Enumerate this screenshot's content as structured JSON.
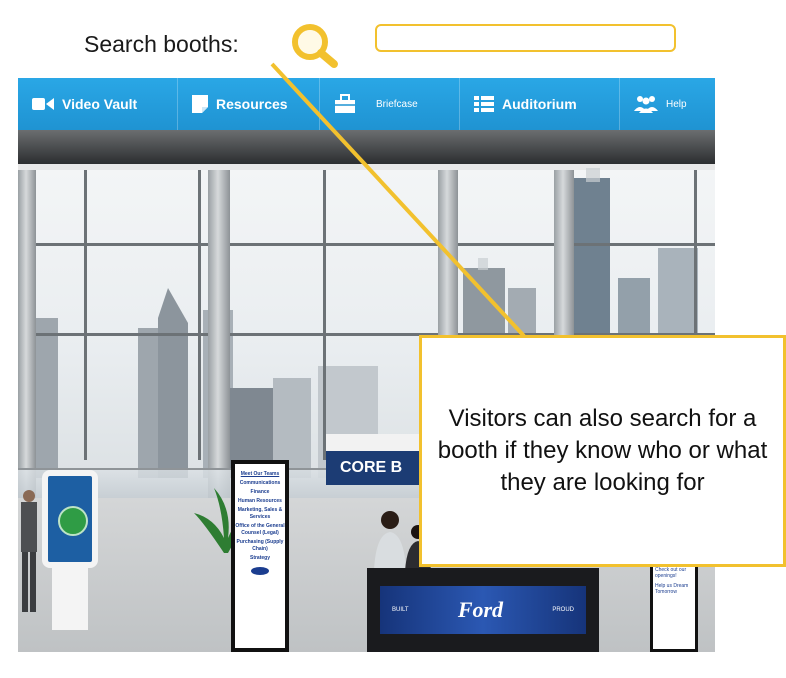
{
  "search": {
    "label": "Search booths:",
    "input_value": "",
    "icon": "magnifier-icon"
  },
  "navbar": {
    "items": [
      {
        "label": "Video Vault",
        "icon": "video-icon"
      },
      {
        "label": "Resources",
        "icon": "notes-icon"
      },
      {
        "label": "Briefcase",
        "icon": "briefcase-icon"
      },
      {
        "label": "Auditorium",
        "icon": "list-icon"
      },
      {
        "label": "Help",
        "icon": "people-icon"
      }
    ]
  },
  "booth": {
    "header": "CORE B",
    "desk_left": "BUILT",
    "desk_logo": "Ford",
    "desk_right": "PROUD"
  },
  "teams_sign": {
    "title": "Meet Our Teams",
    "items": [
      "Communications",
      "Finance",
      "Human Resources",
      "Marketing, Sales & Services",
      "Office of the General Counsel (Legal)",
      "Purchasing (Supply Chain)",
      "Strategy"
    ]
  },
  "right_sign": {
    "lines": [
      "Check out our openings!",
      "Help us Dream Tomorrow"
    ]
  },
  "callout": {
    "text": "Visitors can also search for a booth if they know who or what they are looking for"
  },
  "colors": {
    "accent_yellow": "#f2c12e",
    "nav_blue": "#1f93d2",
    "booth_navy": "#1c3c74"
  }
}
